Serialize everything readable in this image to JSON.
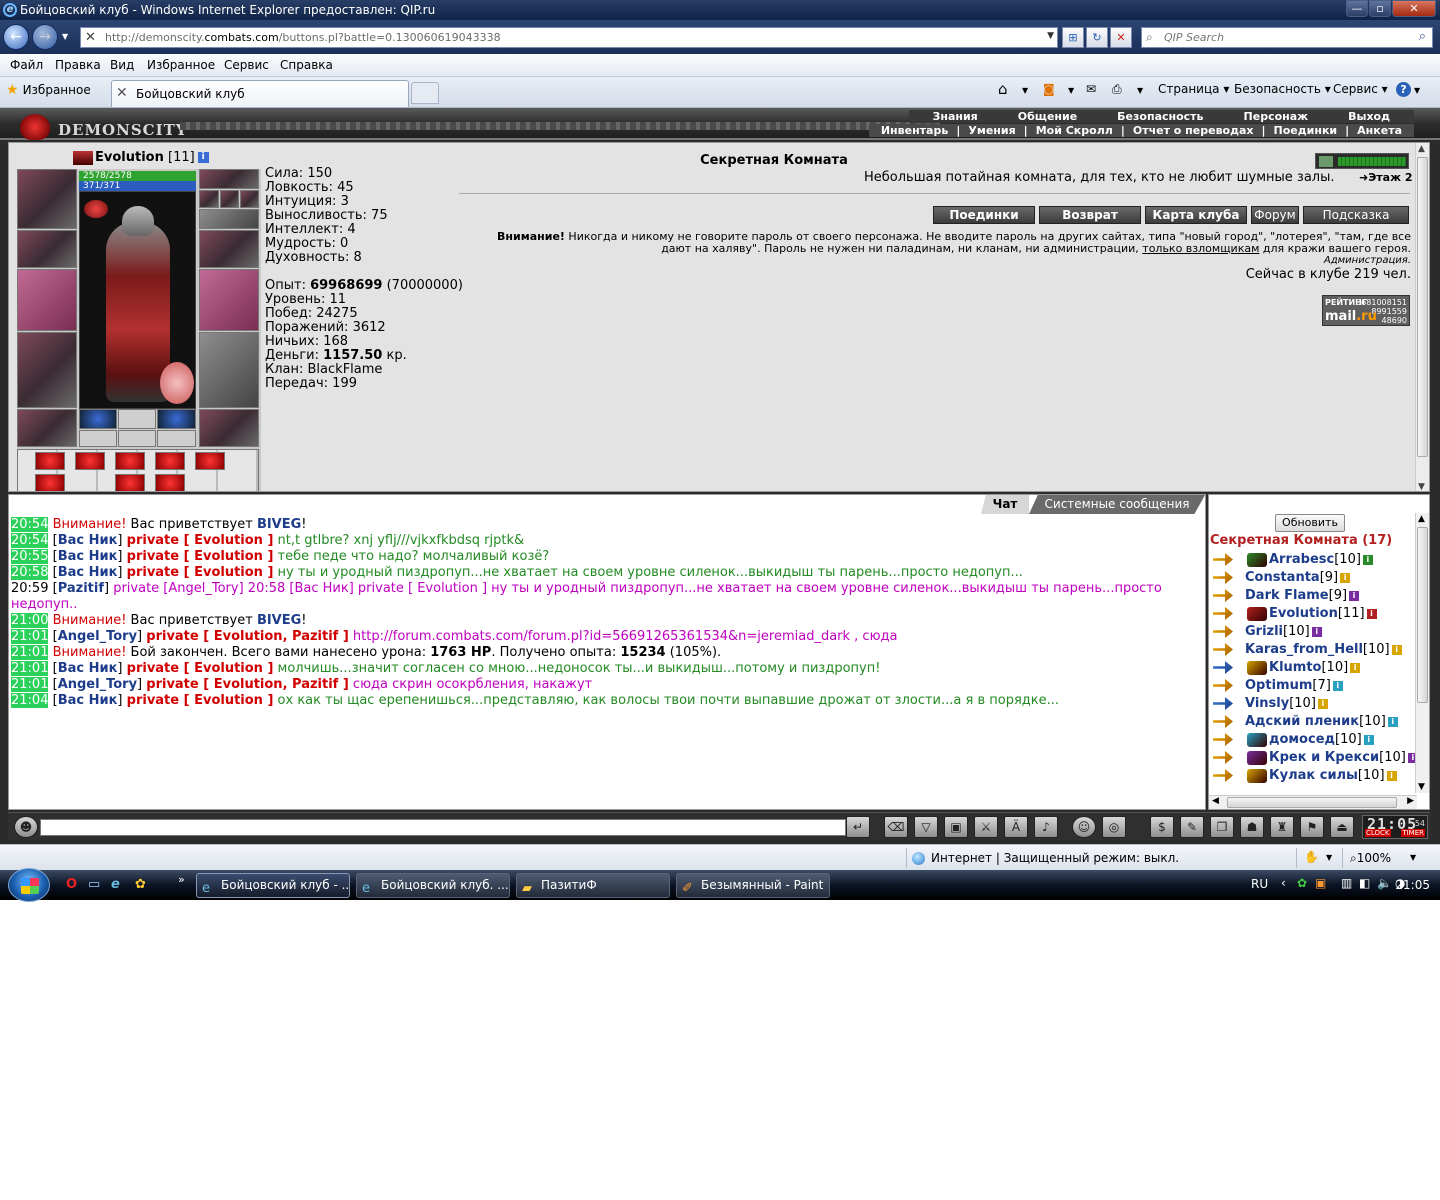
{
  "window": {
    "title": "Бойцовский клуб - Windows Internet Explorer предоставлен: QIP.ru"
  },
  "address": {
    "url_prefix": "http://demonscity.",
    "url_host": "combats.com",
    "url_path": "/buttons.pl?battle=0.130060619043338"
  },
  "search": {
    "placeholder": "QIP Search"
  },
  "menu": [
    "Файл",
    "Правка",
    "Вид",
    "Избранное",
    "Сервис",
    "Справка"
  ],
  "tabbar": {
    "favorites": "Избранное",
    "tab_title": "Бойцовский клуб",
    "tools": [
      "Страница",
      "Безопасность",
      "Сервис"
    ]
  },
  "game": {
    "logo_text": "DEMONSCITY",
    "nav_top": [
      "Знания",
      "Общение",
      "Безопасность",
      "Персонаж",
      "Выход"
    ],
    "nav_bottom": [
      "Инвентарь",
      "Умения",
      "Мой Скролл",
      "Отчет о переводах",
      "Поединки",
      "Анкета"
    ]
  },
  "character": {
    "name": "Evolution",
    "level": "[11]",
    "hp": "2578/2578",
    "mp": "371/371",
    "stats": {
      "sila": "Сила: 150",
      "lovk": "Ловкость: 45",
      "int": "Интуиция: 3",
      "vyn": "Выносливость: 75",
      "intel": "Интеллект: 4",
      "mudr": "Мудрость: 0",
      "duh": "Духовность: 8"
    },
    "exp_label": "Опыт: ",
    "exp_value": "69968699",
    "exp_next": " (70000000)",
    "level_line": "Уровень: 11",
    "wins": "Побед: 24275",
    "losses": "Поражений: 3612",
    "draws": "Ничьих: 168",
    "money_label": "Деньги: ",
    "money_value": "1157.50",
    "money_unit": " кр.",
    "clan": "Клан: BlackFlame",
    "transfers": "Передач: 199"
  },
  "room": {
    "title": "Секретная Комната",
    "desc": "Небольшая потайная комната, для тех, кто не любит шумные залы.",
    "floor": "Этаж 2",
    "buttons": [
      "Поединки",
      "Возврат",
      "Карта клуба",
      "Форум",
      "Подсказка"
    ],
    "warn_head": "Внимание!",
    "warn_text": " Никогда и никому не говорите пароль от своего персонажа. Не вводите пароль на других сайтах, типа \"новый город\", \"лотерея\", \"там, где все дают на халяву\". Пароль не нужен ни паладинам, ни кланам, ни администрации, ",
    "warn_link": "только взломщикам",
    "warn_tail": " для кражи вашего героя.",
    "admin": "Администрация.",
    "online": "Сейчас в клубе 219 чел.",
    "mailru": {
      "label": "РЕЙТИНГ",
      "brand": "mail",
      "brand2": ".ru",
      "n1": "3681008151",
      "n2": "8991559",
      "n3": "48690"
    }
  },
  "chat": {
    "tabs": [
      "Чат",
      "Системные сообщения"
    ],
    "lines": [
      {
        "t": "20:54",
        "a": "Внимание!",
        "b": " Вас приветствует ",
        "c": "BIVEG",
        "d": "!"
      },
      {
        "t": "20:54",
        "nick": "Вас Ник",
        "pv": "private [ Evolution ]",
        "text": " nt,t gtlbre? xnj yflj///vjkxfkbdsq rjptk&"
      },
      {
        "t": "20:55",
        "nick": "Вас Ник",
        "pv": "private [ Evolution ]",
        "text": " тебе педе что надо? молчаливый козё?"
      },
      {
        "t": "20:58",
        "nick": "Вас Ник",
        "pv": "private [ Evolution ]",
        "text": " ну ты и уродный пиздропуп...не хватает на своем уровне силенок...выкидыш ты парень...просто недопуп..."
      },
      {
        "t": "20:59",
        "nick": "Pazitif",
        "text": " private [Angel_Tory] 20:58 [Вас Ник] private [ Evolution ] ну ты и уродный пиздропуп...не хватает на своем уровне силенок...выкидыш ты парень...просто недопуп.."
      },
      {
        "t": "21:00",
        "a": "Внимание!",
        "b": " Вас приветствует ",
        "c": "BIVEG",
        "d": "!"
      },
      {
        "t": "21:01",
        "nick": "Angel_Tory",
        "pv": "private [ Evolution, Pazitif ]",
        "text": " http://forum.combats.com/forum.pl?id=56691265361534&n=jeremiad_dark , сюда"
      },
      {
        "t": "21:01",
        "a": "Внимание!",
        "b": " Бой закончен. Всего вами нанесено урона: ",
        "c": "1763 HP",
        "d": ". Получено опыта: ",
        "e": "15234",
        "f": " (105%)."
      },
      {
        "t": "21:01",
        "nick": "Вас Ник",
        "pv": "private [ Evolution ]",
        "text": " молчишь...значит согласен со мною...недоносок ты...и выкидыш...потому и пиздропуп!"
      },
      {
        "t": "21:01",
        "nick": "Angel_Tory",
        "pv": "private [ Evolution, Pazitif ]",
        "text": " сюда скрин осокрбления, накажут"
      },
      {
        "t": "21:04",
        "nick": "Вас Ник",
        "pv": "private [ Evolution ]",
        "text": " ох как ты щас ерепенишься...представляю, как волосы твои почти выпавшие дрожат от злости...а я в порядке..."
      }
    ]
  },
  "online_list": {
    "refresh": "Обновить",
    "room": "Секретная Комната (17)",
    "users": [
      {
        "name": "Arrabesc",
        "lv": "[10]",
        "sh": true,
        "c": "#2a8a2a"
      },
      {
        "name": "Constanta",
        "lv": "[9]",
        "sh": false,
        "c": "#d8a400"
      },
      {
        "name": "Dark Flame",
        "lv": "[9]",
        "sh": false,
        "c": "#7a2da0"
      },
      {
        "name": "Evolution",
        "lv": "[11]",
        "sh": true,
        "c": "#b02020"
      },
      {
        "name": "Grizli",
        "lv": "[10]",
        "sh": false,
        "c": "#7a2da0"
      },
      {
        "name": "Karas_from_Hell",
        "lv": "[10]",
        "sh": false,
        "c": "#d8a400"
      },
      {
        "name": "Klumto",
        "lv": "[10]",
        "sh": true,
        "c": "#d8a400"
      },
      {
        "name": "Optimum",
        "lv": "[7]",
        "sh": false,
        "c": "#2aa0c0"
      },
      {
        "name": "Vinsly",
        "lv": "[10]",
        "sh": false,
        "c": "#d8a400"
      },
      {
        "name": "Адский пленик",
        "lv": "[10]",
        "sh": false,
        "c": "#2aa0c0"
      },
      {
        "name": "домосед",
        "lv": "[10]",
        "sh": true,
        "c": "#2aa0c0"
      },
      {
        "name": "Крек и Крекси",
        "lv": "[10]",
        "sh": true,
        "c": "#7a2da0"
      },
      {
        "name": "Кулак силы",
        "lv": "[10]",
        "sh": true,
        "c": "#d8a400"
      }
    ]
  },
  "clock": {
    "time": "21:05",
    "sec": "54",
    "l1": "CLOCK",
    "l2": "TIMER"
  },
  "statusbar": {
    "zone": "Интернет | Защищенный режим: выкл.",
    "zoom": "100%"
  },
  "taskbar": {
    "tasks": [
      "Бойцовский клуб - ...",
      "Бойцовский клуб. ...",
      "ПазитиФ",
      "Безымянный - Paint"
    ],
    "lang": "RU",
    "time": "21:05"
  }
}
